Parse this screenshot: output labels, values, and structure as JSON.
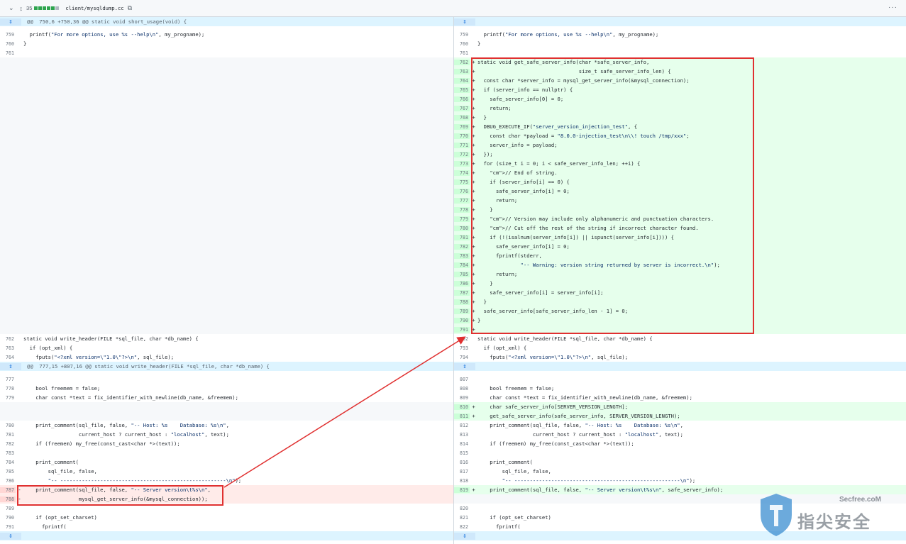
{
  "header": {
    "file_path": "client/mysqldump.cc",
    "changes_count": "35",
    "diffstat": [
      "add",
      "add",
      "add",
      "add",
      "add",
      "neutral"
    ]
  },
  "hunks": {
    "h1": "@@  750,6 +750,36 @@ static void short_usage(void) {",
    "h2": "@@  777,15 +807,16 @@ static void write_header(FILE *sql_file, char *db_name) {"
  },
  "colors": {
    "addition_bg": "#e6ffec",
    "deletion_bg": "#ffebe9",
    "hunk_bg": "#ddf4ff",
    "annotation_red": "#e03030"
  },
  "left_lines": [
    {
      "n": "759",
      "t": "  printf(\"For more options, use %s --help\\n\", my_progname);"
    },
    {
      "n": "760",
      "t": "}"
    },
    {
      "n": "761",
      "t": ""
    },
    {
      "n": "762",
      "t": "static void write_header(FILE *sql_file, char *db_name) {"
    },
    {
      "n": "763",
      "t": "  if (opt_xml) {"
    },
    {
      "n": "764",
      "t": "    fputs(\"<?xml version=\\\"1.0\\\"?>\\n\", sql_file);"
    },
    {
      "n": "777",
      "t": ""
    },
    {
      "n": "778",
      "t": "    bool freemem = false;"
    },
    {
      "n": "779",
      "t": "    char const *text = fix_identifier_with_newline(db_name, &freemem);"
    },
    {
      "n": "780",
      "t": "    print_comment(sql_file, false, \"-- Host: %s    Database: %s\\n\","
    },
    {
      "n": "781",
      "t": "                  current_host ? current_host : \"localhost\", text);"
    },
    {
      "n": "782",
      "t": "    if (freemem) my_free(const_cast<char *>(text));"
    },
    {
      "n": "783",
      "t": ""
    },
    {
      "n": "784",
      "t": "    print_comment("
    },
    {
      "n": "785",
      "t": "        sql_file, false,"
    },
    {
      "n": "786",
      "t": "        \"-- ------------------------------------------------------\\n\");"
    },
    {
      "n": "787",
      "t": "    print_comment(sql_file, false, \"-- Server version\\t%s\\n\","
    },
    {
      "n": "788",
      "t": "                  mysql_get_server_info(&mysql_connection));"
    },
    {
      "n": "789",
      "t": ""
    },
    {
      "n": "790",
      "t": "    if (opt_set_charset)"
    },
    {
      "n": "791",
      "t": "      fprintf("
    }
  ],
  "right_lines": [
    {
      "n": "759",
      "t": "  printf(\"For more options, use %s --help\\n\", my_progname);"
    },
    {
      "n": "760",
      "t": "}"
    },
    {
      "n": "761",
      "t": ""
    },
    {
      "n": "762",
      "t": "static void get_safe_server_info(char *safe_server_info,"
    },
    {
      "n": "763",
      "t": "                                 size_t safe_server_info_len) {"
    },
    {
      "n": "764",
      "t": "  const char *server_info = mysql_get_server_info(&mysql_connection);"
    },
    {
      "n": "765",
      "t": "  if (server_info == nullptr) {"
    },
    {
      "n": "766",
      "t": "    safe_server_info[0] = 0;"
    },
    {
      "n": "767",
      "t": "    return;"
    },
    {
      "n": "768",
      "t": "  }"
    },
    {
      "n": "769",
      "t": "  DBUG_EXECUTE_IF(\"server_version_injection_test\", {"
    },
    {
      "n": "770",
      "t": "    const char *payload = \"8.0.0-injection_test\\n\\\\! touch /tmp/xxx\";"
    },
    {
      "n": "771",
      "t": "    server_info = payload;"
    },
    {
      "n": "772",
      "t": "  });"
    },
    {
      "n": "773",
      "t": "  for (size_t i = 0; i < safe_server_info_len; ++i) {"
    },
    {
      "n": "774",
      "t": "    // End of string."
    },
    {
      "n": "775",
      "t": "    if (server_info[i] == 0) {"
    },
    {
      "n": "776",
      "t": "      safe_server_info[i] = 0;"
    },
    {
      "n": "777",
      "t": "      return;"
    },
    {
      "n": "778",
      "t": "    }"
    },
    {
      "n": "779",
      "t": "    // Version may include only alphanumeric and punctuation characters."
    },
    {
      "n": "780",
      "t": "    // Cut off the rest of the string if incorrect character found."
    },
    {
      "n": "781",
      "t": "    if (!(isalnum(server_info[i]) || ispunct(server_info[i]))) {"
    },
    {
      "n": "782",
      "t": "      safe_server_info[i] = 0;"
    },
    {
      "n": "783",
      "t": "      fprintf(stderr,"
    },
    {
      "n": "784",
      "t": "              \"-- Warning: version string returned by server is incorrect.\\n\");"
    },
    {
      "n": "785",
      "t": "      return;"
    },
    {
      "n": "786",
      "t": "    }"
    },
    {
      "n": "787",
      "t": "    safe_server_info[i] = server_info[i];"
    },
    {
      "n": "788",
      "t": "  }"
    },
    {
      "n": "789",
      "t": "  safe_server_info[safe_server_info_len - 1] = 0;"
    },
    {
      "n": "790",
      "t": "}"
    },
    {
      "n": "791",
      "t": ""
    },
    {
      "n": "792",
      "t": "static void write_header(FILE *sql_file, char *db_name) {"
    },
    {
      "n": "793",
      "t": "  if (opt_xml) {"
    },
    {
      "n": "794",
      "t": "    fputs(\"<?xml version=\\\"1.0\\\"?>\\n\", sql_file);"
    },
    {
      "n": "807",
      "t": ""
    },
    {
      "n": "808",
      "t": "    bool freemem = false;"
    },
    {
      "n": "809",
      "t": "    char const *text = fix_identifier_with_newline(db_name, &freemem);"
    },
    {
      "n": "810",
      "t": "    char safe_server_info[SERVER_VERSION_LENGTH];"
    },
    {
      "n": "811",
      "t": "    get_safe_server_info(safe_server_info, SERVER_VERSION_LENGTH);"
    },
    {
      "n": "812",
      "t": "    print_comment(sql_file, false, \"-- Host: %s    Database: %s\\n\","
    },
    {
      "n": "813",
      "t": "                  current_host ? current_host : \"localhost\", text);"
    },
    {
      "n": "814",
      "t": "    if (freemem) my_free(const_cast<char *>(text));"
    },
    {
      "n": "815",
      "t": ""
    },
    {
      "n": "816",
      "t": "    print_comment("
    },
    {
      "n": "817",
      "t": "        sql_file, false,"
    },
    {
      "n": "818",
      "t": "        \"-- ------------------------------------------------------\\n\");"
    },
    {
      "n": "819",
      "t": "    print_comment(sql_file, false, \"-- Server version\\t%s\\n\", safe_server_info);"
    },
    {
      "n": "820",
      "t": ""
    },
    {
      "n": "821",
      "t": "    if (opt_set_charset)"
    },
    {
      "n": "822",
      "t": "      fprintf("
    }
  ],
  "watermark": {
    "site": "Secfree.coM",
    "brand": "指尖安全"
  }
}
